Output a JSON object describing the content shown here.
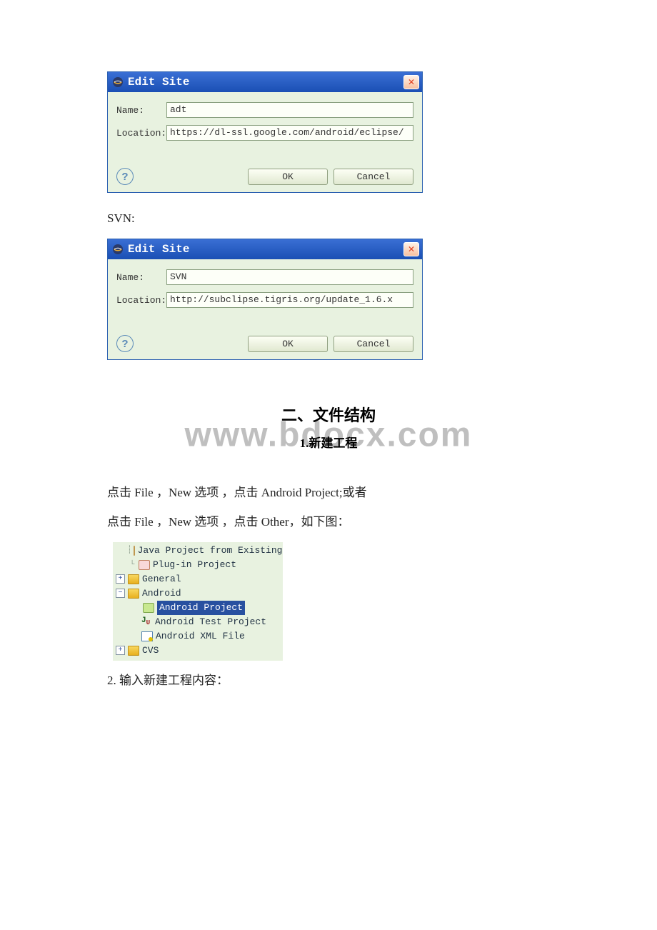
{
  "dialog1": {
    "title": "Edit Site",
    "close_glyph": "✕",
    "name_label": "Name:",
    "name_value": "adt",
    "location_label": "Location:",
    "location_value": "https://dl-ssl.google.com/android/eclipse/",
    "help_glyph": "?",
    "ok_label": "OK",
    "cancel_label": "Cancel"
  },
  "svn_label": "SVN:",
  "dialog2": {
    "title": "Edit Site",
    "close_glyph": "✕",
    "name_label": "Name:",
    "name_value": "SVN",
    "location_label": "Location:",
    "location_value": "http://subclipse.tigris.org/update_1.6.x",
    "help_glyph": "?",
    "ok_label": "OK",
    "cancel_label": "Cancel"
  },
  "watermark_text": "www.bdocx.com",
  "heading1": "二、文件结构",
  "heading2": "1.新建工程",
  "instruction1": "点击 File ，New 选项 ，点击 Android Project;或者",
  "instruction2": " 点击 File ，New 选项 ，点击 Other，如下图：",
  "tree": {
    "item0": "Java Project from Existing",
    "item1": "Plug-in Project",
    "item2": "General",
    "item3": "Android",
    "item3a": "Android Project",
    "item3b": "Android Test Project",
    "item3c": "Android XML File",
    "item4": "CVS"
  },
  "step2": "2. 输入新建工程内容："
}
